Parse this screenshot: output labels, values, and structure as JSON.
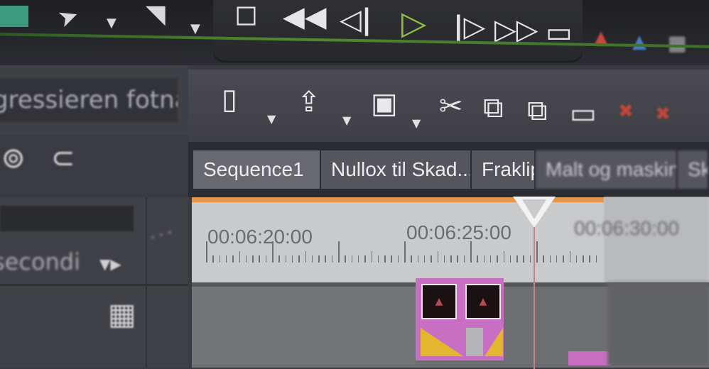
{
  "transport": {
    "icons": [
      "stop-icon",
      "rewind-icon",
      "step-back-icon",
      "play-icon",
      "step-forward-icon",
      "fast-forward-icon",
      "loop-icon"
    ],
    "glyphs": [
      "◻",
      "◀◀",
      "◁|",
      "▷",
      "|▷",
      "▷▷",
      "▭"
    ],
    "accent_play": "#8fbf3f",
    "accent_line": "#4e8a2f"
  },
  "toolbar": {
    "icons": [
      "new-file-icon",
      "open-icon",
      "save-icon",
      "cut-icon",
      "copy-icon",
      "paste-icon",
      "link-icon",
      "delete-icon",
      "delete-icon-2"
    ],
    "glyphs": [
      "▯",
      "⇪",
      "▣",
      "✂",
      "⧉",
      "⧉",
      "▭",
      "✖",
      "✖"
    ]
  },
  "left_panel": {
    "field_text": "gressieren fotnaller",
    "select_text": "secondi"
  },
  "tabs": [
    "Sequence1",
    "Nullox til Skad...",
    "Fraklip",
    "Malt og maskine...",
    "Ska"
  ],
  "ruler": {
    "timecodes": [
      "00:06:20:00",
      "00:06:25:00",
      "00:06:30:00"
    ],
    "accent": "#e4964a"
  },
  "clip_color": "#c86fc3"
}
